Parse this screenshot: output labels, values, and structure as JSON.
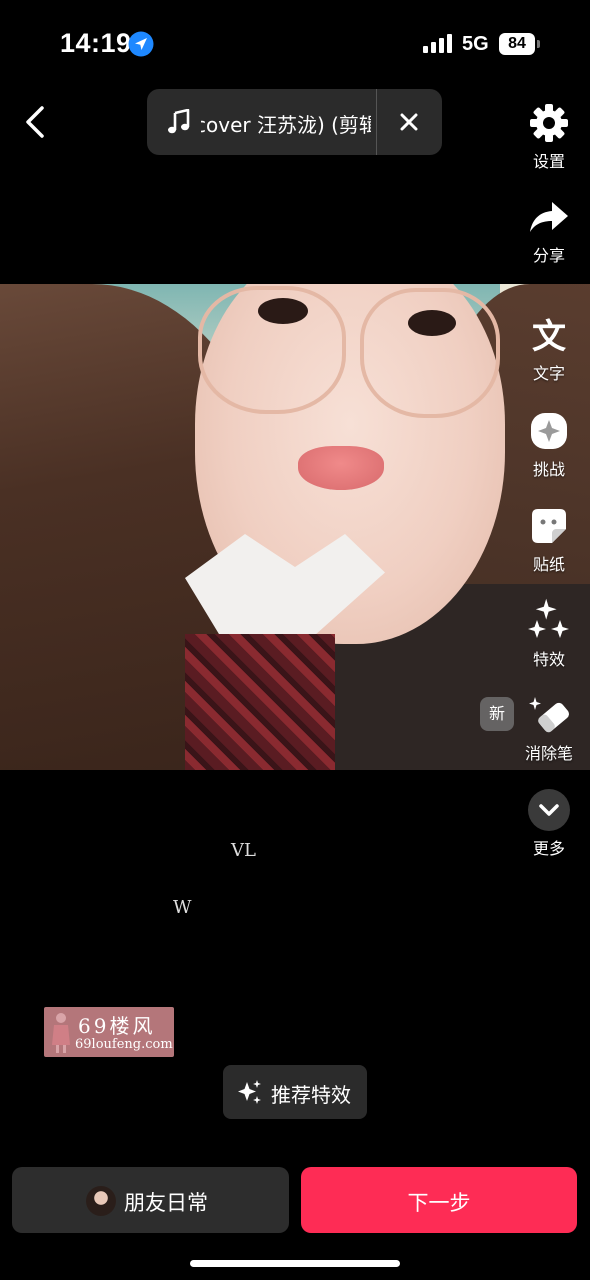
{
  "status_bar": {
    "time": "14:19",
    "network": "5G",
    "battery": "84"
  },
  "top_bar": {
    "music_title": "cover 汪苏泷) (剪辑"
  },
  "toolbar": {
    "settings_label": "设置",
    "share_label": "分享",
    "text_label": "文字",
    "challenge_label": "挑战",
    "sticker_label": "贴纸",
    "effects_label": "特效",
    "eraser_label": "消除笔",
    "new_badge": "新",
    "more_label": "更多"
  },
  "overlay": {
    "text_1": "VL",
    "text_2": "W"
  },
  "watermark": {
    "main": "69楼风",
    "url": "69loufeng.com"
  },
  "recommend": {
    "label": "推荐特效"
  },
  "bottom": {
    "friends_label": "朋友日常",
    "next_label": "下一步"
  },
  "colors": {
    "background": "#000000",
    "accent": "#fe2c55",
    "panel": "#2d2d2d",
    "location_blue": "#1e88ff"
  }
}
